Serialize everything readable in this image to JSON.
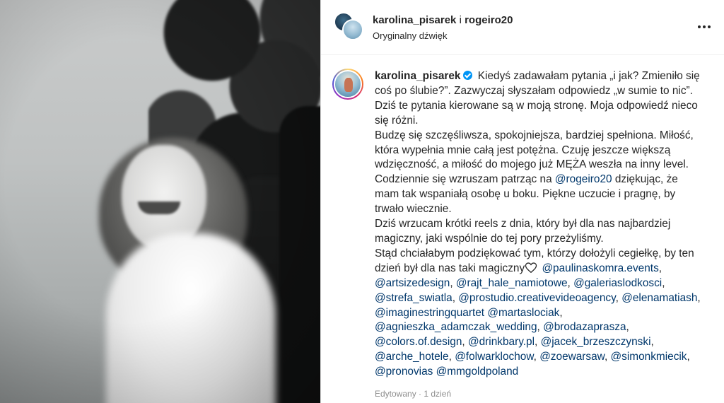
{
  "header": {
    "user1": "karolina_pisarek",
    "joiner": " i ",
    "user2": "rogeiro20",
    "audio": "Oryginalny dźwięk"
  },
  "comment": {
    "username": "karolina_pisarek",
    "text_1": "Kiedyś zadawałam pytania „i jak? Zmieniło się coś po ślubie?”. Zazwyczaj słyszałam odpowiedz „w sumie to nic”. Dziś te pytania kierowane są w moją stronę. Moja odpowiedź nieco się różni.\nBudzę się szczęśliwsza, spokojniejsza, bardziej spełniona. Miłość, która wypełnia mnie całą jest potężna. Czuję jeszcze większą wdzięczność, a miłość do mojego już MĘŻA weszła na inny level. Codziennie się wzruszam patrząc na ",
    "mention_rogeiro": "@rogeiro20",
    "text_2": " dziękując, że mam tak wspaniałą osobę u boku. Piękne uczucie i pragnę, by trwało wiecznie.\nDziś wrzucam krótki reels z dnia, który był dla nas najbardziej magiczny, jaki wspólnie do tej pory przeżyliśmy.\nStąd chciałabym podziękować tym, którzy dołożyli cegiełkę, by ten dzień był dla nas taki magiczny",
    "mentions": [
      "@paulinaskomra.events",
      "@artsizedesign",
      "@rajt_hale_namiotowe",
      "@galeriaslodkosci",
      "@strefa_swiatla",
      "@prostudio.creativevideoagency",
      "@elenamatiash",
      "@imaginestringquartet",
      "@martaslociak",
      "@agnieszka_adamczak_wedding",
      "@brodazaprasza",
      "@colors.of.design",
      "@drinkbary.pl",
      "@jacek_brzeszczynski",
      "@arche_hotele",
      "@folwarklochow",
      "@zoewarsaw",
      "@simonkmiecik",
      "@pronovias",
      "@mmgoldpoland"
    ],
    "edited": "Edytowany",
    "dot": " · ",
    "time": "1 dzień"
  },
  "icons": {
    "more": "more-options-icon",
    "verified": "verified-badge-icon",
    "heart": "heart-outline-icon"
  },
  "colors": {
    "mention": "#00376b",
    "verified": "#0095f6",
    "meta": "#8e8e8e"
  }
}
